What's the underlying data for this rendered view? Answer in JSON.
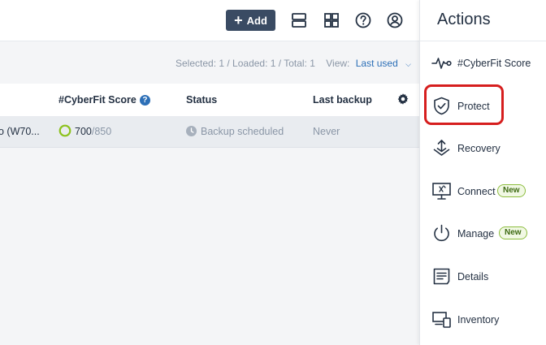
{
  "toolbar": {
    "add_label": "Add",
    "icons": [
      "rows-layout-icon",
      "grid-layout-icon",
      "help-icon",
      "account-icon"
    ]
  },
  "list": {
    "selected_label": "Selected: 1 / Loaded: 1 / Total: 1",
    "view_label": "View:",
    "view_value": "Last used"
  },
  "table": {
    "headers": [
      "#CyberFit Score",
      "Status",
      "Last backup"
    ],
    "help_badge": "?",
    "rows": [
      {
        "name": "o (W70...",
        "score": "700",
        "score_max": "/850",
        "status": "Backup scheduled",
        "last_backup": "Never"
      }
    ]
  },
  "actions": {
    "title": "Actions",
    "new_badge": "New",
    "items": [
      {
        "label": "#CyberFit Score",
        "icon": "pulse-icon",
        "new": false
      },
      {
        "label": "Protect",
        "icon": "shield-check-icon",
        "new": false
      },
      {
        "label": "Recovery",
        "icon": "recovery-icon",
        "new": false
      },
      {
        "label": "Connect",
        "icon": "monitor-connect-icon",
        "new": true
      },
      {
        "label": "Manage",
        "icon": "power-icon",
        "new": true
      },
      {
        "label": "Details",
        "icon": "document-icon",
        "new": false
      },
      {
        "label": "Inventory",
        "icon": "devices-icon",
        "new": false
      }
    ]
  },
  "colors": {
    "accent": "#2c6fb7",
    "add_button": "#3a4b63",
    "highlight": "#d61e1e",
    "score_ring": "#8dc21f",
    "new_badge_border": "#8dbd3f"
  }
}
